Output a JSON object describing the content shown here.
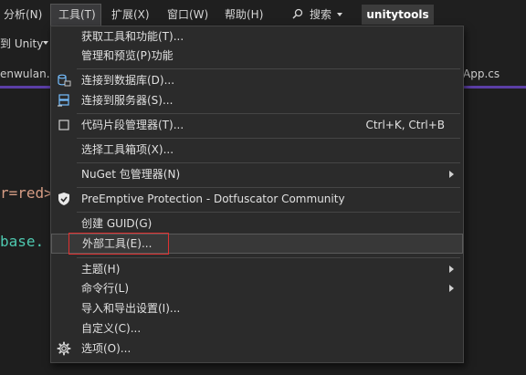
{
  "menubar": {
    "items": [
      {
        "label": "分析(N)"
      },
      {
        "label": "工具(T)"
      },
      {
        "label": "扩展(X)"
      },
      {
        "label": "窗口(W)"
      },
      {
        "label": "帮助(H)"
      }
    ],
    "search_label": "搜索",
    "solution_name": "unitytools"
  },
  "toolbar": {
    "target_label": "到 Unity"
  },
  "tabs": {
    "left": "enwulan.c",
    "right": "App.cs"
  },
  "editor": {
    "line1": "r=red>",
    "line2": "base."
  },
  "colors": {
    "accent": "#5b3ea6",
    "highlight_box": "#e03030",
    "menu_bg": "#2b2b2b"
  },
  "tools_menu": {
    "items": [
      {
        "label": "获取工具和功能(T)...",
        "icon": ""
      },
      {
        "label": "管理和预览(P)功能",
        "icon": ""
      },
      {
        "label": "连接到数据库(D)...",
        "icon": "database-connect-icon"
      },
      {
        "label": "连接到服务器(S)...",
        "icon": "server-connect-icon"
      },
      {
        "label": "代码片段管理器(T)...",
        "icon": "checkbox-icon",
        "shortcut": "Ctrl+K, Ctrl+B"
      },
      {
        "label": "选择工具箱项(X)...",
        "icon": ""
      },
      {
        "label": "NuGet 包管理器(N)",
        "icon": "",
        "submenu": true
      },
      {
        "label": "PreEmptive Protection - Dotfuscator Community",
        "icon": "shield-icon"
      },
      {
        "label": "创建 GUID(G)",
        "icon": ""
      },
      {
        "label": "外部工具(E)...",
        "icon": ""
      },
      {
        "label": "主题(H)",
        "icon": "",
        "submenu": true
      },
      {
        "label": "命令行(L)",
        "icon": "",
        "submenu": true
      },
      {
        "label": "导入和导出设置(I)...",
        "icon": ""
      },
      {
        "label": "自定义(C)...",
        "icon": ""
      },
      {
        "label": "选项(O)...",
        "icon": "gear-icon"
      }
    ]
  }
}
